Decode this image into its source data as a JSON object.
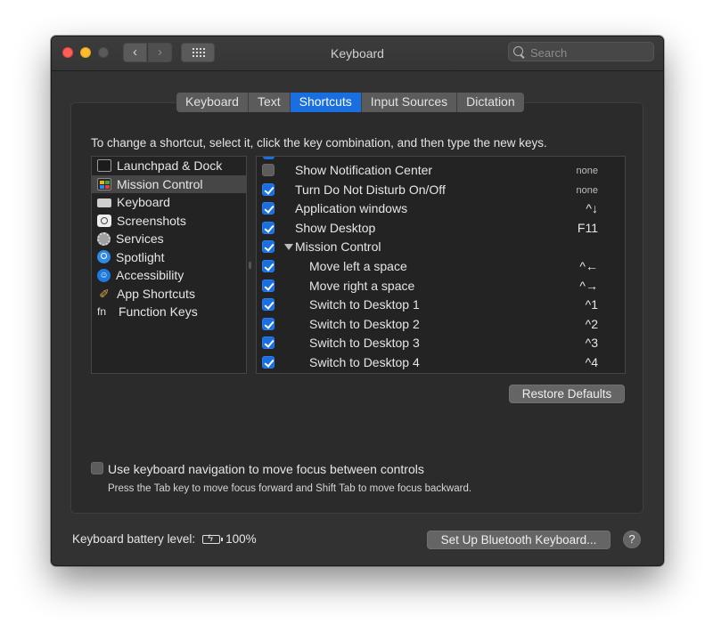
{
  "window": {
    "title": "Keyboard",
    "search_placeholder": "Search",
    "nav_back": "‹",
    "nav_forward": "›"
  },
  "tabs": [
    {
      "label": "Keyboard",
      "active": false
    },
    {
      "label": "Text",
      "active": false
    },
    {
      "label": "Shortcuts",
      "active": true
    },
    {
      "label": "Input Sources",
      "active": false
    },
    {
      "label": "Dictation",
      "active": false
    }
  ],
  "instruction": "To change a shortcut, select it, click the key combination, and then type the new keys.",
  "categories": [
    {
      "label": "Launchpad & Dock",
      "icon": "launchpad-icon",
      "selected": false
    },
    {
      "label": "Mission Control",
      "icon": "mission-control-icon",
      "selected": true
    },
    {
      "label": "Keyboard",
      "icon": "keyboard-icon",
      "selected": false
    },
    {
      "label": "Screenshots",
      "icon": "screenshot-icon",
      "selected": false
    },
    {
      "label": "Services",
      "icon": "gear-icon",
      "selected": false
    },
    {
      "label": "Spotlight",
      "icon": "spotlight-icon",
      "selected": false
    },
    {
      "label": "Accessibility",
      "icon": "accessibility-icon",
      "selected": false
    },
    {
      "label": "App Shortcuts",
      "icon": "app-shortcuts-icon",
      "selected": false
    },
    {
      "label": "Function Keys",
      "icon": "fn-icon",
      "selected": false
    }
  ],
  "shortcuts": [
    {
      "label": "Show Notification Center",
      "keys": "none",
      "checked": false,
      "level": 1
    },
    {
      "label": "Turn Do Not Disturb On/Off",
      "keys": "none",
      "checked": true,
      "level": 1
    },
    {
      "label": "Application windows",
      "keys": "^↓",
      "checked": true,
      "level": 1
    },
    {
      "label": "Show Desktop",
      "keys": "F11",
      "checked": true,
      "level": 1
    },
    {
      "label": "Mission Control",
      "keys": "",
      "checked": true,
      "level": 1,
      "group": true
    },
    {
      "label": "Move left a space",
      "keys": "^←",
      "checked": true,
      "level": 2
    },
    {
      "label": "Move right a space",
      "keys": "^→",
      "checked": true,
      "level": 2
    },
    {
      "label": "Switch to Desktop 1",
      "keys": "^1",
      "checked": true,
      "level": 2
    },
    {
      "label": "Switch to Desktop 2",
      "keys": "^2",
      "checked": true,
      "level": 2
    },
    {
      "label": "Switch to Desktop 3",
      "keys": "^3",
      "checked": true,
      "level": 2
    },
    {
      "label": "Switch to Desktop 4",
      "keys": "^4",
      "checked": true,
      "level": 2
    }
  ],
  "restore_defaults": "Restore Defaults",
  "keyboard_navigation": {
    "label": "Use keyboard navigation to move focus between controls",
    "checked": false,
    "hint": "Press the Tab key to move focus forward and Shift Tab to move focus backward."
  },
  "battery": {
    "label": "Keyboard battery level:",
    "value": "100%"
  },
  "bluetooth_button": "Set Up Bluetooth Keyboard...",
  "help_label": "?",
  "colors": {
    "accent": "#1a6fe0",
    "window_bg": "#323232"
  }
}
